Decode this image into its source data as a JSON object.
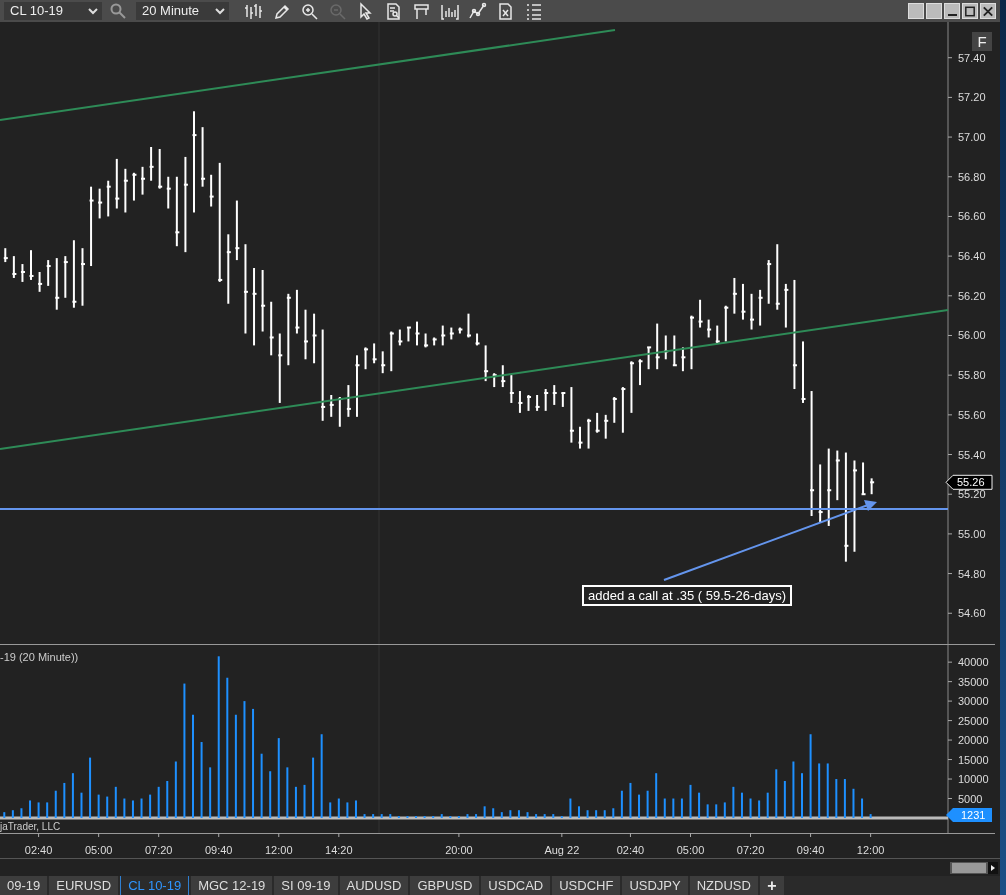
{
  "toolbar": {
    "instrument": "CL 10-19",
    "interval": "20 Minute",
    "tools": [
      {
        "kind": "bars",
        "disabled": false
      },
      {
        "kind": "pencil",
        "disabled": false
      },
      {
        "kind": "zoom-in",
        "disabled": false
      },
      {
        "kind": "zoom-out",
        "disabled": true
      },
      {
        "kind": "pointer",
        "disabled": false
      },
      {
        "kind": "document-search",
        "disabled": false
      },
      {
        "kind": "frame",
        "disabled": false
      },
      {
        "kind": "bracket-bars",
        "disabled": false
      },
      {
        "kind": "line-graph",
        "disabled": false
      },
      {
        "kind": "document-x",
        "disabled": false
      },
      {
        "kind": "list",
        "disabled": false
      }
    ]
  },
  "price_panel": {
    "button": "F",
    "current_price": "55.26",
    "note": "added a call at .35 ( 59.5-26-days)",
    "chart_data": {
      "type": "scatter",
      "ylim": [
        54.44,
        57.58
      ],
      "categories": [
        null,
        null,
        null,
        null,
        null,
        null,
        null,
        null,
        null,
        null,
        null,
        null,
        null,
        null,
        null,
        null,
        null,
        null,
        null,
        null,
        null,
        null,
        null,
        null,
        null,
        null,
        null,
        null,
        null,
        null,
        null,
        null,
        null,
        null,
        null,
        null,
        null,
        null,
        null,
        null,
        null,
        null,
        null,
        null,
        null,
        null,
        null,
        null,
        null,
        null,
        null,
        null,
        null,
        null,
        null,
        null,
        null,
        null,
        null,
        null,
        null,
        null,
        null,
        null,
        null,
        null,
        null,
        null,
        null,
        null,
        null,
        null,
        null,
        null,
        null,
        null,
        null,
        null,
        null,
        null,
        null,
        null,
        null,
        null,
        null,
        null,
        null,
        null,
        null,
        null,
        null,
        null,
        null,
        null,
        null,
        null,
        null,
        null,
        null,
        null,
        null,
        null,
        null,
        null,
        null,
        null,
        null,
        null,
        null,
        null,
        null,
        null,
        null,
        null,
        null,
        null
      ],
      "yticks": [
        {
          "value": 54.6,
          "label": "54.60"
        },
        {
          "value": 54.8,
          "label": "54.80"
        },
        {
          "value": 55,
          "label": "55.00"
        },
        {
          "value": 55.2,
          "label": "55.20"
        },
        {
          "value": 55.4,
          "label": "55.40"
        },
        {
          "value": 55.6,
          "label": "55.60"
        },
        {
          "value": 55.8,
          "label": "55.80"
        },
        {
          "value": 56,
          "label": "56.00"
        },
        {
          "value": 56.2,
          "label": "56.20"
        },
        {
          "value": 56.4,
          "label": "56.40"
        },
        {
          "value": 56.6,
          "label": "56.60"
        },
        {
          "value": 56.8,
          "label": "56.80"
        },
        {
          "value": 57,
          "label": "57.00"
        },
        {
          "value": 57.2,
          "label": "57.20"
        },
        {
          "value": 57.4,
          "label": "57.40"
        }
      ],
      "series": [
        {
          "color": "#ffffff",
          "values": [
            56.39,
            56.31,
            56.32,
            56.3,
            56.26,
            56.35,
            56.19,
            56.37,
            56.17,
            56.36,
            56.68,
            56.67,
            56.75,
            56.69,
            56.78,
            56.81,
            56.79,
            56.85,
            56.75,
            56.74,
            56.52,
            56.76,
            57.01,
            56.79,
            56.7,
            56.28,
            56.42,
            56.44,
            56.22,
            56.21,
            56.15,
            55.99,
            55.9,
            56.19,
            56.04,
            55.97,
            56.0,
            55.64,
            55.65,
            55.68,
            55.63,
            55.85,
            55.93,
            55.88,
            55.85,
            56.01,
            55.97,
            56.04,
            56.01,
            55.95,
            55.98,
            56.0,
            56.01,
            56.03,
            56.0,
            55.96,
            55.82,
            55.8,
            55.77,
            55.71,
            55.66,
            55.69,
            55.64,
            55.71,
            55.71,
            55.71,
            55.52,
            55.46,
            55.57,
            55.52,
            55.57,
            55.68,
            55.73,
            55.86,
            55.87,
            55.94,
            55.89,
            55.92,
            55.85,
            55.89,
            56.09,
            56.07,
            56.03,
            55.97,
            56.14,
            56.21,
            56.12,
            56.08,
            56.19,
            56.36,
            56.16,
            56.23,
            55.85,
            55.68,
            55.22,
            55.11,
            55.22,
            55.37,
            54.94,
            55.32,
            55.2,
            55.26,
            null,
            null,
            null,
            null,
            null,
            null,
            null,
            null,
            null,
            null,
            null,
            null,
            null,
            null
          ],
          "errors": [
            [
              56.37,
              56.44
            ],
            [
              56.29,
              56.4
            ],
            [
              56.27,
              56.36
            ],
            [
              56.28,
              56.43
            ],
            [
              56.22,
              56.32
            ],
            [
              56.25,
              56.38
            ],
            [
              56.13,
              56.39
            ],
            [
              56.19,
              56.4
            ],
            [
              56.14,
              56.48
            ],
            [
              56.15,
              56.44
            ],
            [
              56.35,
              56.75
            ],
            [
              56.59,
              56.74
            ],
            [
              56.6,
              56.78
            ],
            [
              56.64,
              56.89
            ],
            [
              56.62,
              56.84
            ],
            [
              56.68,
              56.82
            ],
            [
              56.71,
              56.85
            ],
            [
              56.78,
              56.95
            ],
            [
              56.74,
              56.94
            ],
            [
              56.64,
              56.8
            ],
            [
              56.45,
              56.8
            ],
            [
              56.42,
              56.9
            ],
            [
              56.62,
              57.13
            ],
            [
              56.75,
              57.05
            ],
            [
              56.65,
              56.81
            ],
            [
              56.27,
              56.87
            ],
            [
              56.16,
              56.51
            ],
            [
              56.38,
              56.68
            ],
            [
              56.01,
              56.46
            ],
            [
              55.95,
              56.34
            ],
            [
              56.02,
              56.33
            ],
            [
              55.9,
              56.17
            ],
            [
              55.66,
              56.01
            ],
            [
              55.85,
              56.21
            ],
            [
              56.01,
              56.23
            ],
            [
              55.88,
              56.13
            ],
            [
              55.86,
              56.11
            ],
            [
              55.57,
              56.03
            ],
            [
              55.59,
              55.7
            ],
            [
              55.54,
              55.69
            ],
            [
              55.59,
              55.75
            ],
            [
              55.59,
              55.9
            ],
            [
              55.83,
              55.94
            ],
            [
              55.86,
              55.96
            ],
            [
              55.81,
              55.92
            ],
            [
              55.82,
              56.02
            ],
            [
              55.95,
              56.03
            ],
            [
              55.97,
              56.04
            ],
            [
              55.95,
              56.07
            ],
            [
              55.94,
              56.01
            ],
            [
              55.95,
              55.99
            ],
            [
              55.95,
              56.05
            ],
            [
              55.98,
              56.04
            ],
            [
              56.01,
              56.04
            ],
            [
              55.99,
              56.11
            ],
            [
              55.95,
              56.01
            ],
            [
              55.77,
              55.95
            ],
            [
              55.74,
              55.81
            ],
            [
              55.74,
              55.85
            ],
            [
              55.66,
              55.8
            ],
            [
              55.61,
              55.72
            ],
            [
              55.62,
              55.7
            ],
            [
              55.62,
              55.7
            ],
            [
              55.62,
              55.73
            ],
            [
              55.65,
              55.75
            ],
            [
              55.64,
              55.71
            ],
            [
              55.46,
              55.74
            ],
            [
              55.43,
              55.54
            ],
            [
              55.43,
              55.58
            ],
            [
              55.51,
              55.61
            ],
            [
              55.48,
              55.6
            ],
            [
              55.56,
              55.69
            ],
            [
              55.51,
              55.74
            ],
            [
              55.61,
              55.87
            ],
            [
              55.75,
              55.88
            ],
            [
              55.83,
              55.94
            ],
            [
              55.83,
              56.06
            ],
            [
              55.88,
              56.0
            ],
            [
              55.85,
              56.0
            ],
            [
              55.82,
              55.94
            ],
            [
              55.83,
              56.1
            ],
            [
              56.04,
              56.18
            ],
            [
              55.99,
              56.08
            ],
            [
              55.96,
              56.05
            ],
            [
              55.97,
              56.15
            ],
            [
              56.11,
              56.29
            ],
            [
              56.08,
              56.26
            ],
            [
              56.03,
              56.21
            ],
            [
              56.05,
              56.23
            ],
            [
              56.16,
              56.38
            ],
            [
              56.13,
              56.46
            ],
            [
              56.04,
              56.26
            ],
            [
              55.73,
              56.28
            ],
            [
              55.66,
              55.97
            ],
            [
              55.09,
              55.72
            ],
            [
              55.06,
              55.35
            ],
            [
              55.04,
              55.43
            ],
            [
              55.17,
              55.42
            ],
            [
              54.86,
              55.41
            ],
            [
              54.91,
              55.37
            ],
            [
              55.2,
              55.36
            ],
            [
              55.2,
              55.28
            ],
            null,
            null,
            null,
            null,
            null,
            null,
            null,
            null,
            null,
            null,
            null,
            null,
            null,
            null
          ]
        }
      ]
    }
  },
  "volume_panel": {
    "title": "-19 (20 Minute))",
    "credit": "jaTrader, LLC",
    "current_volume": "1231",
    "chart_data": {
      "type": "bar",
      "ylim": [
        0,
        44400
      ],
      "categories": [
        null,
        null,
        null,
        null,
        "02:40",
        null,
        null,
        null,
        null,
        null,
        null,
        "05:00",
        null,
        null,
        null,
        null,
        null,
        null,
        "07:20",
        null,
        null,
        null,
        null,
        null,
        null,
        "09:40",
        null,
        null,
        null,
        null,
        null,
        null,
        "12:00",
        null,
        null,
        null,
        null,
        null,
        null,
        "14:20",
        null,
        null,
        null,
        null,
        null,
        null,
        null,
        null,
        null,
        null,
        null,
        null,
        null,
        "20:00",
        null,
        null,
        null,
        null,
        null,
        null,
        null,
        null,
        null,
        null,
        null,
        "Aug 22",
        null,
        null,
        null,
        null,
        null,
        null,
        null,
        "02:40",
        null,
        null,
        null,
        null,
        null,
        null,
        "05:00",
        null,
        null,
        null,
        null,
        null,
        null,
        "07:20",
        null,
        null,
        null,
        null,
        null,
        null,
        "09:40",
        null,
        null,
        null,
        null,
        null,
        null,
        "12:00",
        null,
        null,
        null,
        null,
        null,
        null,
        null,
        null,
        null,
        null,
        null,
        null,
        null,
        null
      ],
      "yticks": [
        {
          "value": 5000,
          "label": "5000"
        },
        {
          "value": 10000,
          "label": "10000"
        },
        {
          "value": 15000,
          "label": "15000"
        },
        {
          "value": 20000,
          "label": "20000"
        },
        {
          "value": 25000,
          "label": "25000"
        },
        {
          "value": 30000,
          "label": "30000"
        },
        {
          "value": 35000,
          "label": "35000"
        },
        {
          "value": 40000,
          "label": "40000"
        }
      ],
      "series": [
        {
          "color": "#1e90ff",
          "values": [
            1500,
            2000,
            2500,
            4500,
            4000,
            4000,
            7000,
            9000,
            11500,
            6500,
            15500,
            6000,
            5500,
            8000,
            5000,
            4500,
            5000,
            6000,
            8000,
            9500,
            14500,
            34500,
            26500,
            19500,
            13000,
            41500,
            36000,
            26500,
            30000,
            28000,
            16500,
            12000,
            20500,
            13000,
            8000,
            8500,
            15500,
            21500,
            4000,
            5000,
            4000,
            4500,
            1000,
            1000,
            1000,
            1000,
            500,
            500,
            500,
            500,
            500,
            1000,
            500,
            500,
            1000,
            1000,
            3000,
            2500,
            1500,
            2000,
            2000,
            1500,
            1000,
            1000,
            1000,
            500,
            5000,
            3000,
            2000,
            2000,
            2000,
            2500,
            7000,
            9000,
            6000,
            7000,
            11500,
            5000,
            5000,
            5000,
            8500,
            6500,
            3500,
            3500,
            4000,
            8000,
            6500,
            5000,
            4500,
            6500,
            12500,
            9500,
            14500,
            11500,
            21500,
            14000,
            14000,
            10000,
            10000,
            7500,
            5000,
            1000,
            null,
            null,
            null,
            null,
            null,
            null,
            null,
            null,
            null,
            null,
            null,
            null,
            null,
            null
          ]
        }
      ]
    }
  },
  "tabs": [
    {
      "label": "09-19",
      "selected": false
    },
    {
      "label": "EURUSD",
      "selected": false
    },
    {
      "label": "CL 10-19",
      "selected": true
    },
    {
      "label": "MGC 12-19",
      "selected": false
    },
    {
      "label": "SI 09-19",
      "selected": false
    },
    {
      "label": "AUDUSD",
      "selected": false
    },
    {
      "label": "GBPUSD",
      "selected": false
    },
    {
      "label": "USDCAD",
      "selected": false
    },
    {
      "label": "USDCHF",
      "selected": false
    },
    {
      "label": "USDJPY",
      "selected": false
    },
    {
      "label": "NZDUSD",
      "selected": false
    }
  ],
  "add_tab": "+"
}
